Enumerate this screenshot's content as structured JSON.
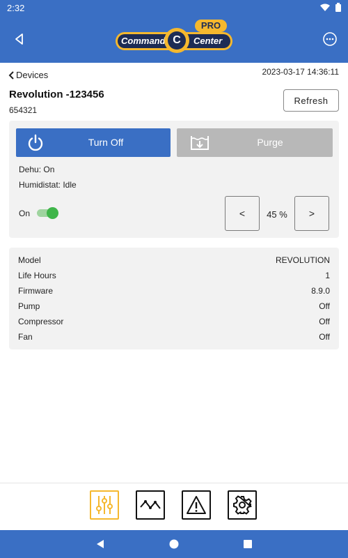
{
  "status_bar": {
    "time": "2:32"
  },
  "app_bar": {
    "logo": {
      "badge": "PRO",
      "word_left": "Command",
      "word_right": "Center",
      "mark": "C"
    }
  },
  "header": {
    "back_link": "Devices",
    "timestamp": "2023-03-17 14:36:11",
    "device_title": "Revolution -123456",
    "device_serial": "654321",
    "refresh_label": "Refresh"
  },
  "controls": {
    "turn_off_label": "Turn Off",
    "purge_label": "Purge",
    "dehu_status": "Dehu: On",
    "humidistat_status": "Humidistat: Idle",
    "toggle_label": "On",
    "toggle_on": true,
    "decrement_label": "<",
    "increment_label": ">",
    "setpoint_display": "45 %"
  },
  "info": {
    "rows": [
      {
        "key": "Model",
        "value": "REVOLUTION"
      },
      {
        "key": "Life Hours",
        "value": "1"
      },
      {
        "key": "Firmware",
        "value": "8.9.0"
      },
      {
        "key": "Pump",
        "value": "Off"
      },
      {
        "key": "Compressor",
        "value": "Off"
      },
      {
        "key": "Fan",
        "value": "Off"
      }
    ]
  },
  "bottom_tabs": [
    {
      "icon": "sliders-icon",
      "active": true
    },
    {
      "icon": "trend-graph-icon",
      "active": false
    },
    {
      "icon": "warning-icon",
      "active": false
    },
    {
      "icon": "gear-icon",
      "active": false
    }
  ],
  "colors": {
    "primary": "#3a6fc4",
    "accent": "#f5b82e",
    "disabled": "#b8b8b8",
    "toggle_on": "#3fb54a",
    "card_bg": "#f2f2f2"
  }
}
